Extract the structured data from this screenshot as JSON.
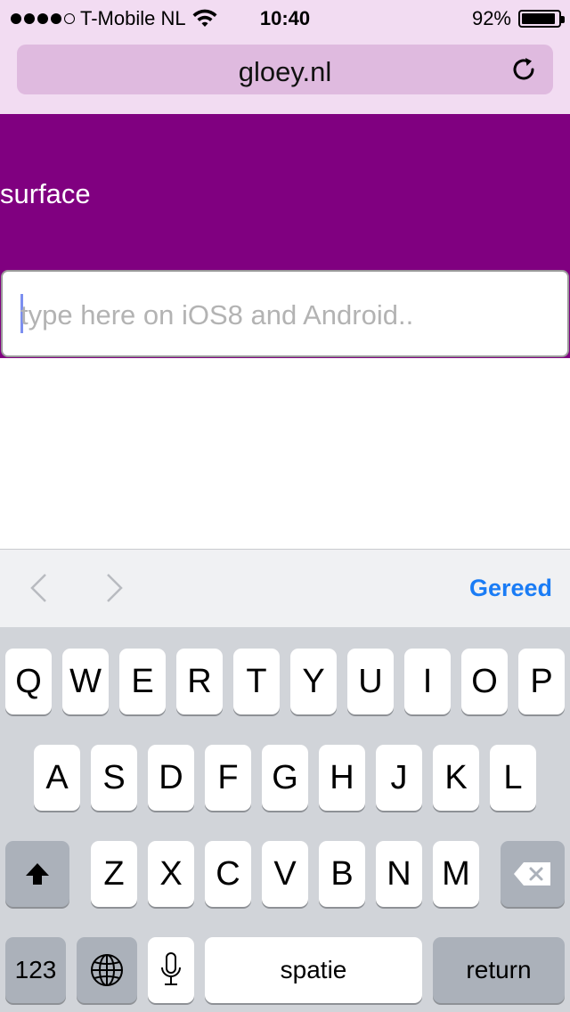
{
  "status_bar": {
    "carrier": "T-Mobile NL",
    "time": "10:40",
    "battery_text": "92%",
    "battery_level": 0.92,
    "signal_bars_filled": 4,
    "signal_bars_total": 5
  },
  "browser": {
    "url": "gloey.nl",
    "reload_icon": "reload-icon"
  },
  "page": {
    "hero_label": "surface",
    "hero_color": "#800080",
    "input_placeholder": "type here on iOS8 and Android..",
    "input_value": ""
  },
  "accessory_bar": {
    "prev_icon": "chevron-left-icon",
    "next_icon": "chevron-right-icon",
    "done_label": "Gereed",
    "done_color": "#1a7cf5"
  },
  "keyboard": {
    "row1": [
      "Q",
      "W",
      "E",
      "R",
      "T",
      "Y",
      "U",
      "I",
      "O",
      "P"
    ],
    "row2": [
      "A",
      "S",
      "D",
      "F",
      "G",
      "H",
      "J",
      "K",
      "L"
    ],
    "row3": [
      "Z",
      "X",
      "C",
      "V",
      "B",
      "N",
      "M"
    ],
    "shift_icon": "shift-icon",
    "backspace_icon": "backspace-icon",
    "numbers_label": "123",
    "globe_icon": "globe-icon",
    "mic_icon": "microphone-icon",
    "space_label": "spatie",
    "return_label": "return"
  }
}
